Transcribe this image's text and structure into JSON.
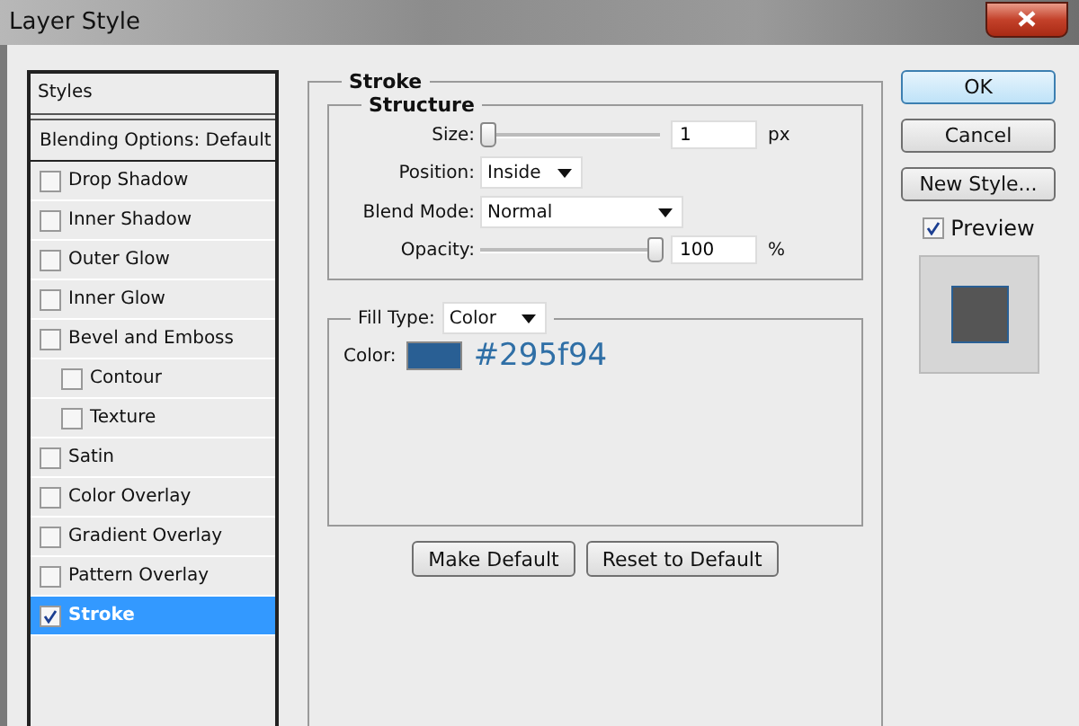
{
  "window": {
    "title": "Layer Style"
  },
  "styles_panel": {
    "header": "Styles",
    "blending": {
      "label": "Blending Options: Default",
      "selected": false
    },
    "items": [
      {
        "label": "Drop Shadow",
        "checked": false,
        "selected": false
      },
      {
        "label": "Inner Shadow",
        "checked": false,
        "selected": false
      },
      {
        "label": "Outer Glow",
        "checked": false,
        "selected": false
      },
      {
        "label": "Inner Glow",
        "checked": false,
        "selected": false
      },
      {
        "label": "Bevel and Emboss",
        "checked": false,
        "selected": false,
        "children": [
          {
            "label": "Contour",
            "checked": false,
            "selected": false
          },
          {
            "label": "Texture",
            "checked": false,
            "selected": false
          }
        ]
      },
      {
        "label": "Satin",
        "checked": false,
        "selected": false
      },
      {
        "label": "Color Overlay",
        "checked": false,
        "selected": false
      },
      {
        "label": "Gradient Overlay",
        "checked": false,
        "selected": false
      },
      {
        "label": "Pattern Overlay",
        "checked": false,
        "selected": false
      },
      {
        "label": "Stroke",
        "checked": true,
        "selected": true
      }
    ]
  },
  "stroke": {
    "title": "Stroke",
    "structure": {
      "title": "Structure",
      "size": {
        "label": "Size:",
        "level": 0,
        "value": "1",
        "unit": "px"
      },
      "position": {
        "label": "Position:",
        "value": "Inside"
      },
      "blend_mode": {
        "label": "Blend Mode:",
        "value": "Normal"
      },
      "opacity": {
        "label": "Opacity:",
        "level": 1,
        "value": "100",
        "unit": "%"
      }
    },
    "fill": {
      "label": "Fill Type:",
      "value": "Color",
      "color_label": "Color:",
      "color": "#295f94",
      "hex": "#295f94"
    },
    "buttons": [
      {
        "label": "Make Default"
      },
      {
        "label": "Reset to Default"
      }
    ]
  },
  "side_buttons": [
    {
      "label": "OK",
      "default": true
    },
    {
      "label": "Cancel",
      "default": false
    },
    {
      "label": "New Style...",
      "default": false
    }
  ],
  "preview": {
    "label": "Preview",
    "checked": true
  }
}
